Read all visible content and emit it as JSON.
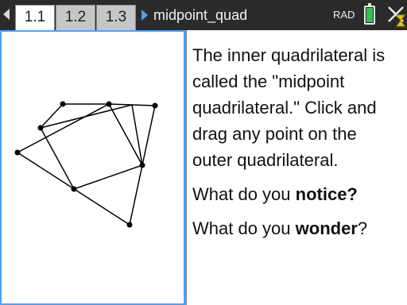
{
  "tabs": [
    {
      "label": "1.1",
      "active": true
    },
    {
      "label": "1.2",
      "active": false
    },
    {
      "label": "1.3",
      "active": false
    }
  ],
  "document": {
    "name": "midpoint_quad"
  },
  "status": {
    "angle_mode": "RAD",
    "battery_level": 0.9
  },
  "notes": {
    "paragraph1": "The inner quadrilateral is called the \"midpoint quadrilateral.\" Click and drag any point on the outer quadrilateral.",
    "q1_prefix": "What do you ",
    "q1_bold": "notice?",
    "q2_prefix": "What do you ",
    "q2_bold": "wonder",
    "q2_suffix": "?"
  },
  "colors": {
    "topbar": "#2b2b2b",
    "active_border": "#4aa3ff",
    "battery": "#36c24a",
    "busy_icon": "#f2c200"
  },
  "icons": {
    "nav_left": "triangle-left-icon",
    "doc": "triangle-right-icon",
    "battery": "battery-icon",
    "close": "close-icon",
    "busy": "hourglass-icon"
  }
}
